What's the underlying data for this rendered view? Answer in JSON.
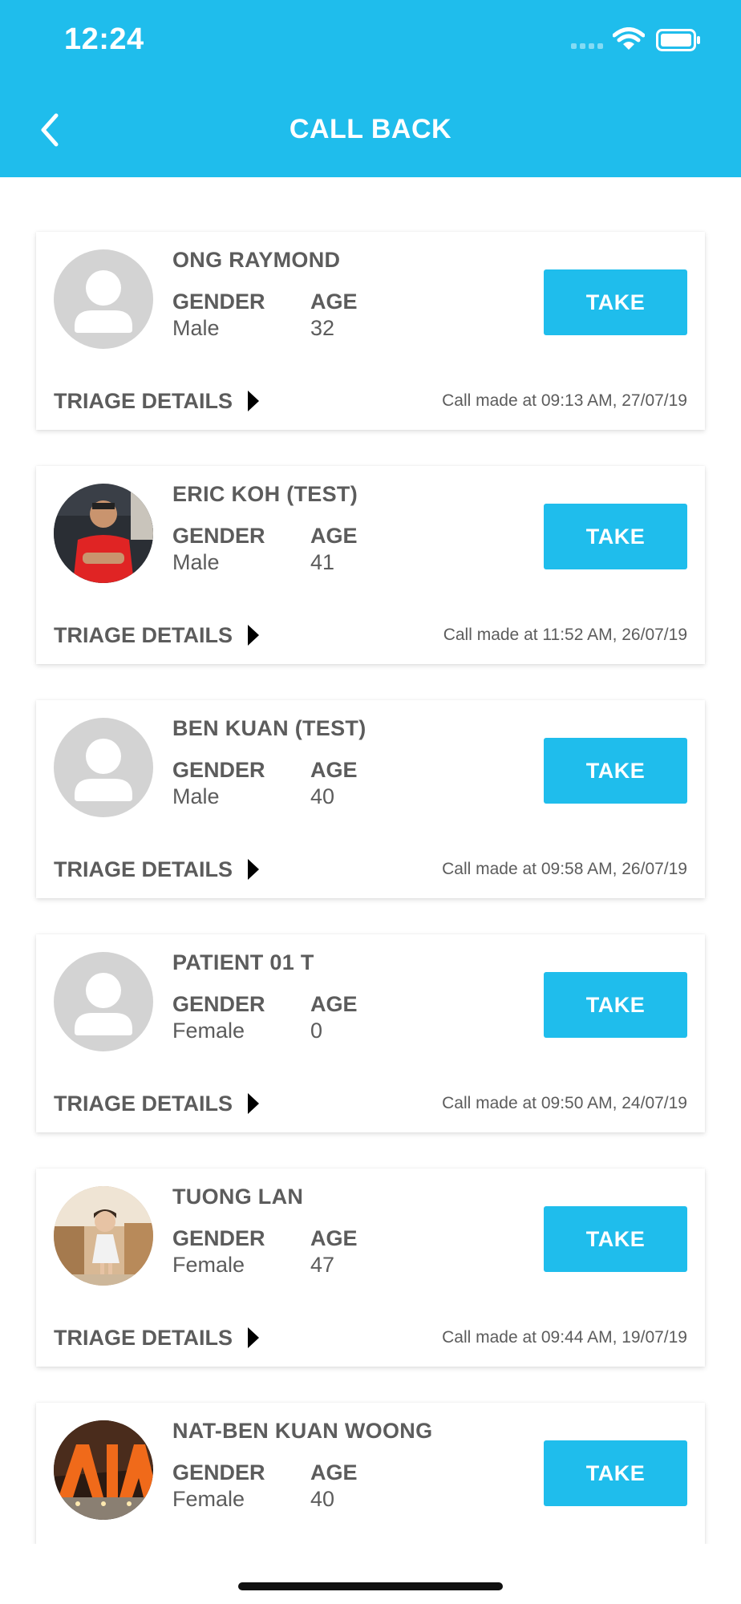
{
  "status_bar": {
    "time": "12:24"
  },
  "header": {
    "title": "CALL BACK",
    "back_icon": "chevron-left-icon"
  },
  "labels": {
    "gender": "GENDER",
    "age": "AGE",
    "take": "TAKE",
    "triage": "TRIAGE DETAILS"
  },
  "colors": {
    "accent": "#1fbdec",
    "text": "#5c5c5c",
    "placeholder": "#d3d3d3"
  },
  "patients": [
    {
      "name": "ONG RAYMOND",
      "gender": "Male",
      "age": "32",
      "call_time": "Call made at 09:13 AM, 27/07/19",
      "avatar": "placeholder"
    },
    {
      "name": "ERIC KOH (TEST)",
      "gender": "Male",
      "age": "41",
      "call_time": "Call made at 11:52 AM, 26/07/19",
      "avatar": "photo-man-red-shirt"
    },
    {
      "name": "BEN KUAN (TEST)",
      "gender": "Male",
      "age": "40",
      "call_time": "Call made at 09:58 AM, 26/07/19",
      "avatar": "placeholder"
    },
    {
      "name": "PATIENT 01 T",
      "gender": "Female",
      "age": "0",
      "call_time": "Call made at 09:50 AM, 24/07/19",
      "avatar": "placeholder"
    },
    {
      "name": "TUONG LAN",
      "gender": "Female",
      "age": "47",
      "call_time": "Call made at 09:44 AM, 19/07/19",
      "avatar": "photo-child"
    },
    {
      "name": "NAT-BEN KUAN WOONG",
      "gender": "Female",
      "age": "40",
      "call_time": "",
      "avatar": "photo-aia-sign"
    }
  ]
}
